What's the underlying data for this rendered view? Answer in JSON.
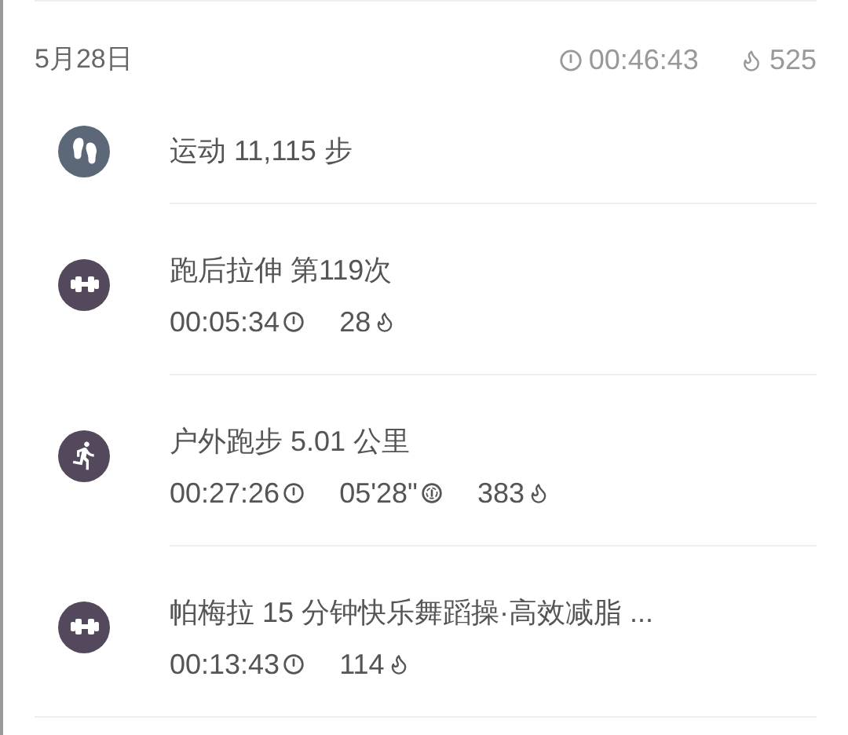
{
  "day": {
    "date": "5月28日",
    "total_duration": "00:46:43",
    "total_calories": "525"
  },
  "activities": [
    {
      "kind": "steps",
      "title": "运动 11,115 步"
    },
    {
      "kind": "strength",
      "title": "跑后拉伸 第119次",
      "stats": [
        {
          "kind": "duration",
          "value": "00:05:34"
        },
        {
          "kind": "calories",
          "value": "28"
        }
      ]
    },
    {
      "kind": "run",
      "title": "户外跑步 5.01 公里",
      "stats": [
        {
          "kind": "duration",
          "value": "00:27:26"
        },
        {
          "kind": "pace",
          "value": "05'28\""
        },
        {
          "kind": "calories",
          "value": "383"
        }
      ]
    },
    {
      "kind": "strength",
      "title": "帕梅拉 15 分钟快乐舞蹈操·高效减脂 ...",
      "stats": [
        {
          "kind": "duration",
          "value": "00:13:43"
        },
        {
          "kind": "calories",
          "value": "114"
        }
      ]
    }
  ]
}
